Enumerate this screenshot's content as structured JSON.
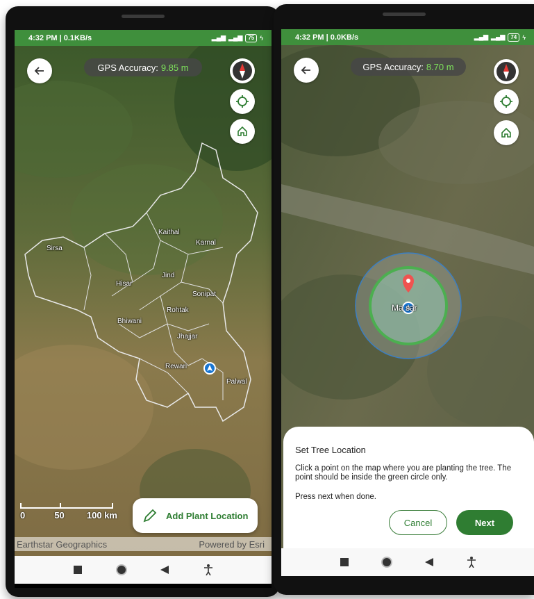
{
  "left_screen": {
    "status_bar": {
      "time_speed": "4:32 PM | 0.1KB/s",
      "battery": "75"
    },
    "gps_label": "GPS Accuracy:",
    "gps_value": "9.85 m",
    "districts": [
      {
        "name": "Sirsa"
      },
      {
        "name": "Kaithal"
      },
      {
        "name": "Karnal"
      },
      {
        "name": "Jind"
      },
      {
        "name": "Hisar"
      },
      {
        "name": "Sonipat"
      },
      {
        "name": "Rohtak"
      },
      {
        "name": "Bhiwani"
      },
      {
        "name": "Jhajjar"
      },
      {
        "name": "Rewari"
      },
      {
        "name": "Palwal"
      }
    ],
    "scale_labels": [
      "0",
      "50",
      "100 km"
    ],
    "add_button_label": "Add Plant Location",
    "attribution_left": "Earthstar Geographics",
    "attribution_right": "Powered by Esri"
  },
  "right_screen": {
    "status_bar": {
      "time_speed": "4:32 PM | 0.0KB/s",
      "battery": "74"
    },
    "gps_label": "GPS Accuracy:",
    "gps_value": "8.70 m",
    "place_label": "Ma  sar",
    "sheet": {
      "title": "Set Tree Location",
      "description": "Click a point on the map where you are planting the tree. The point should be inside the green circle only.",
      "hint": "Press next when done.",
      "cancel_label": "Cancel",
      "next_label": "Next"
    }
  },
  "colors": {
    "status_green": "#3f8f3c",
    "accent_green": "#2f7d32",
    "gps_value_green": "#7ee25b",
    "circle_outline": "#4caf50"
  }
}
